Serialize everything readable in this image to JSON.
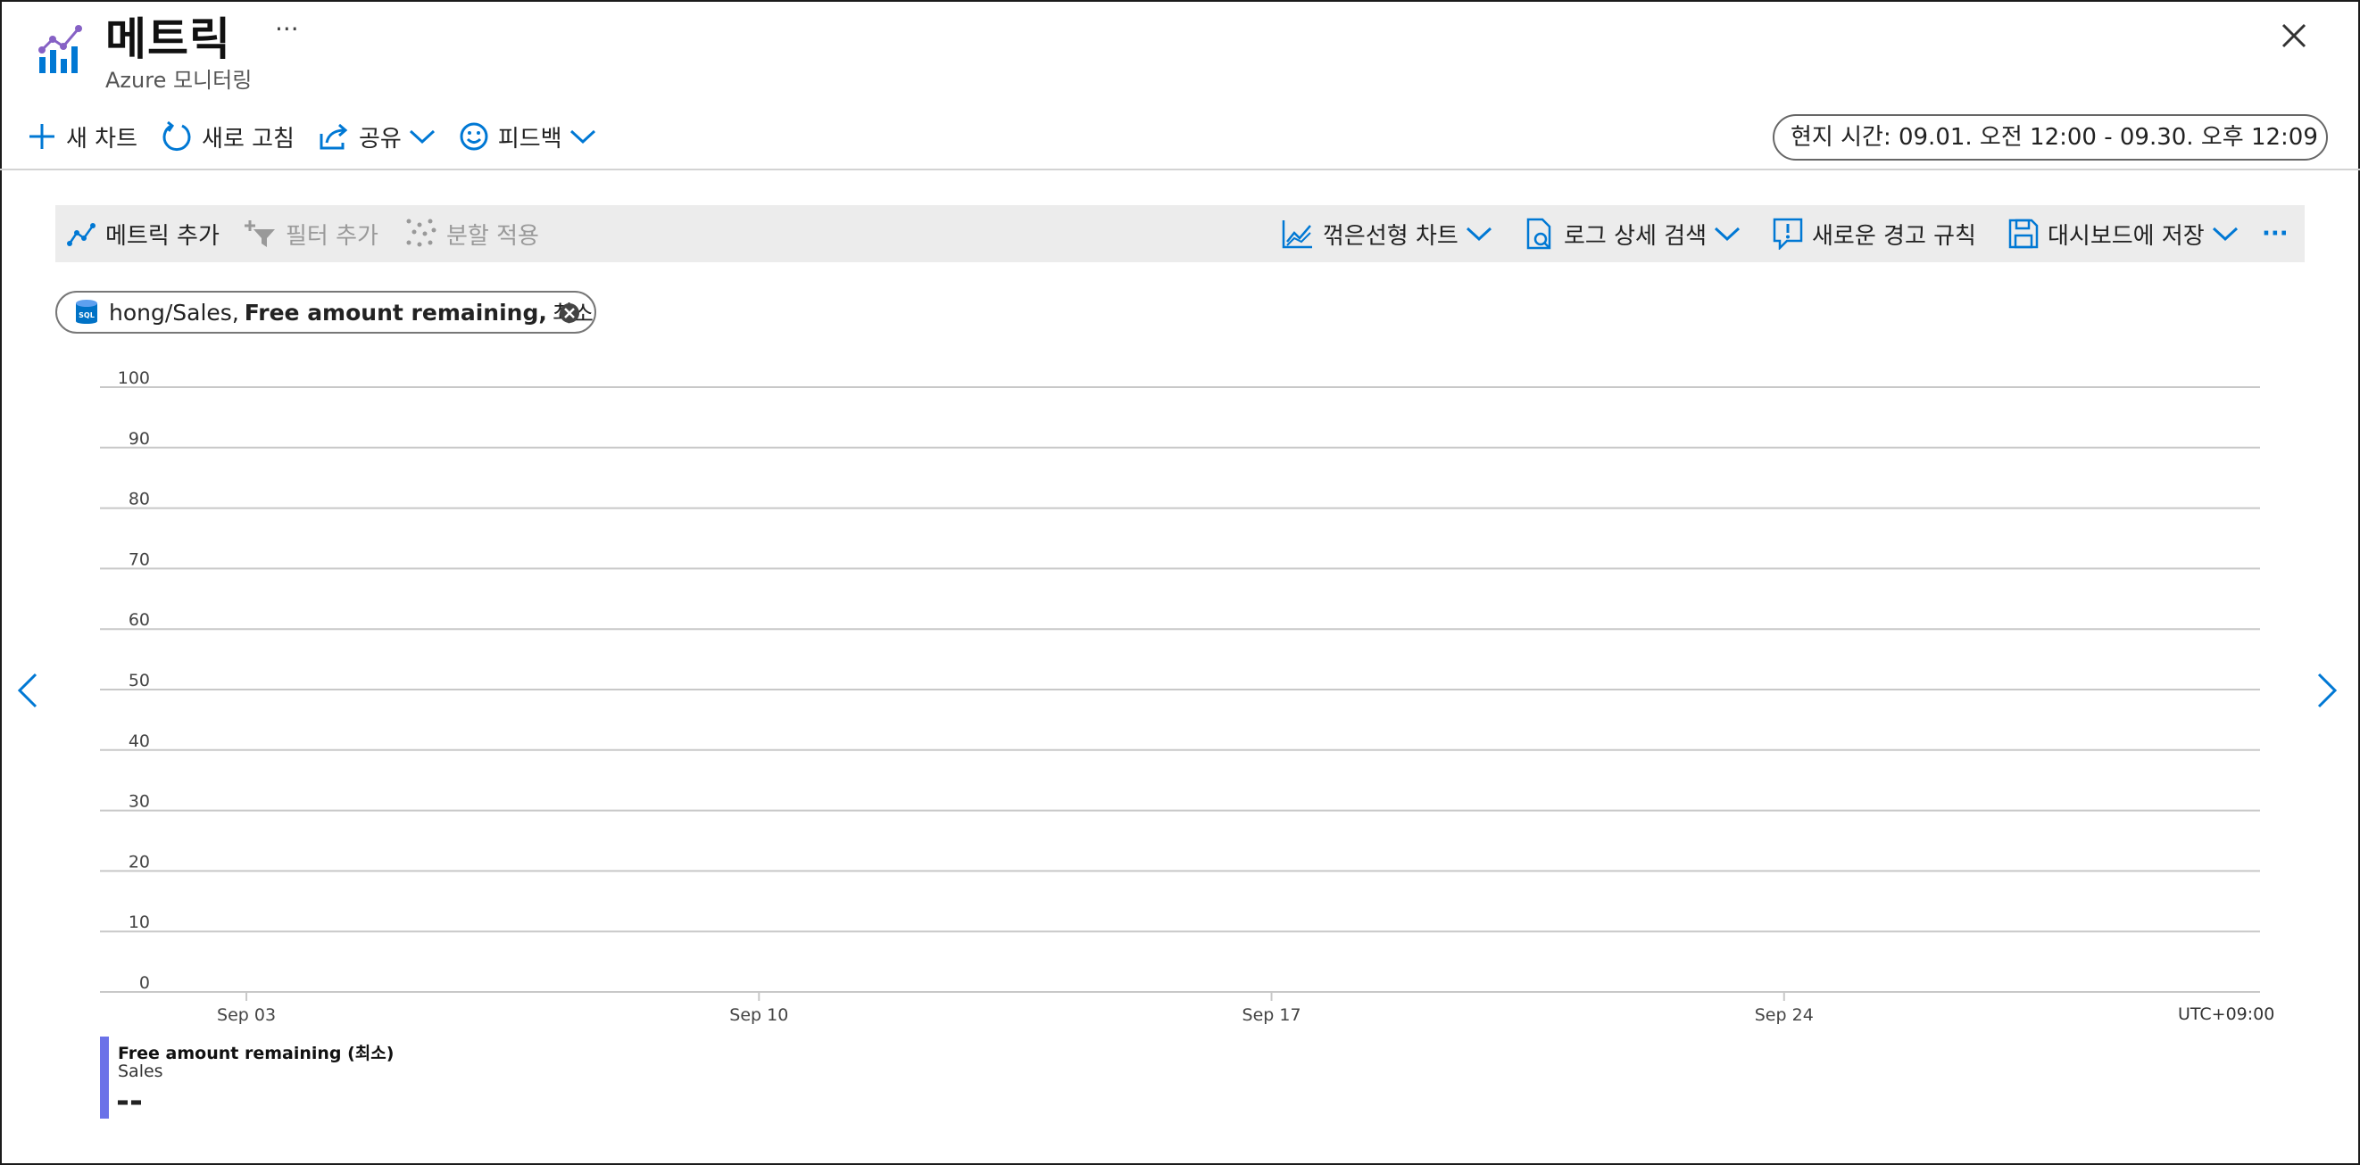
{
  "header": {
    "title": "메트릭",
    "more": "···",
    "subtitle": "Azure 모니터링"
  },
  "commands": {
    "new_chart": "새 차트",
    "refresh": "새로 고침",
    "share": "공유",
    "feedback": "피드백"
  },
  "time_range": "현지 시간: 09.01. 오전 12:00 - 09.30. 오후 12:09 (...",
  "toolbar": {
    "add_metric": "메트릭 추가",
    "add_filter": "필터 추가",
    "apply_split": "분할 적용",
    "line_chart": "꺾은선형 차트",
    "log_search": "로그 상세 검색",
    "new_alert": "새로운 경고 규칙",
    "save_dashboard": "대시보드에 저장",
    "more": "···"
  },
  "metric_pill": {
    "resource": "hong/Sales,",
    "metric": "Free amount remaining,",
    "aggregation": "최소"
  },
  "chart_data": {
    "type": "line",
    "y_ticks": [
      "100",
      "90",
      "80",
      "70",
      "60",
      "50",
      "40",
      "30",
      "20",
      "10",
      "0"
    ],
    "ylim": [
      0,
      100
    ],
    "x_ticks": [
      "Sep 03",
      "Sep 10",
      "Sep 17",
      "Sep 24"
    ],
    "timezone": "UTC+09:00",
    "series": [
      {
        "name": "Free amount remaining (최소)",
        "resource": "Sales",
        "value": "--",
        "color": "#6b72e8",
        "values": []
      }
    ],
    "grid": true
  },
  "icons": {
    "logo": "metrics-chart-icon",
    "close": "close-icon",
    "prev": "chevron-left-icon",
    "next": "chevron-right-icon"
  },
  "colors": {
    "accent": "#0078d4",
    "legend": "#6b72e8"
  }
}
